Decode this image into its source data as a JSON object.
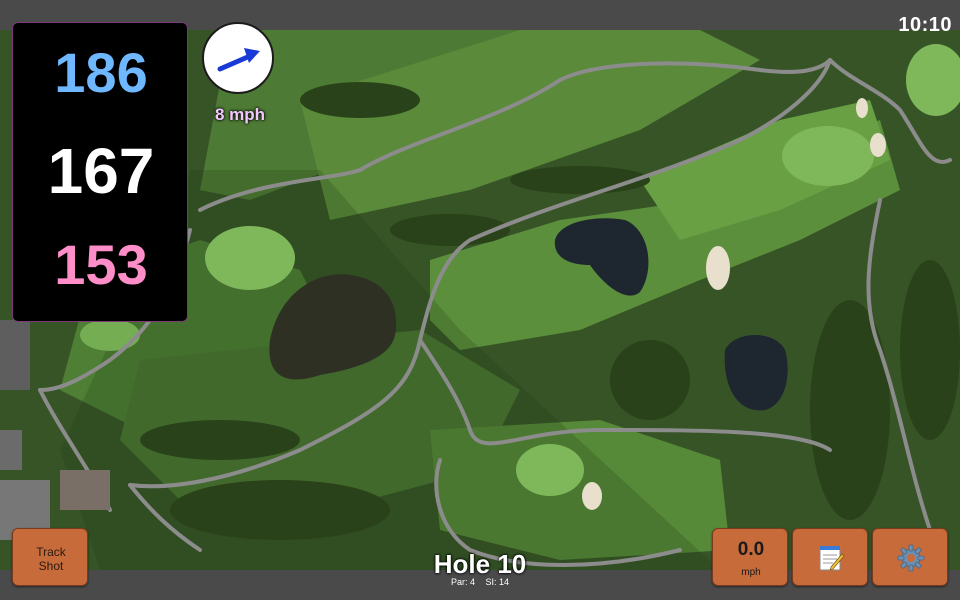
{
  "clock": "10:10",
  "distances": {
    "back": "186",
    "center": "167",
    "front": "153",
    "colors": {
      "back": "#6fb8ff",
      "center": "#ffffff",
      "front": "#ff8ec8"
    }
  },
  "wind": {
    "indicator_icon": "wind-direction-arrow-icon",
    "speed_label": "8 mph"
  },
  "buttons": {
    "track_shot": {
      "line1": "Track",
      "line2": "Shot"
    },
    "wind_speed": {
      "value": "0.0",
      "unit": "mph"
    },
    "notes_icon": "notepad-icon",
    "settings_icon": "gear-icon"
  },
  "hole": {
    "title": "Hole 10",
    "par": "Par: 4",
    "stroke_index": "SI: 14"
  },
  "colors": {
    "button_bg": "#c86b3a",
    "panel_bg": "#000000",
    "bar_bg": "#4a4a4a"
  }
}
